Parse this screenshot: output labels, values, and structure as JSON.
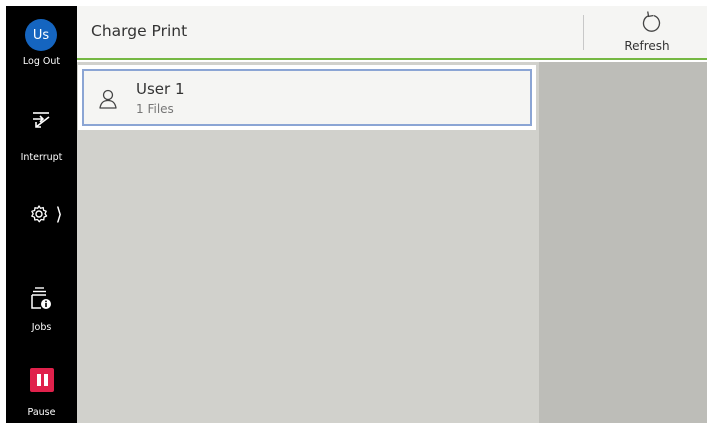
{
  "sidebar": {
    "avatar_initials": "Us",
    "logout_label": "Log Out",
    "interrupt_label": "Interrupt",
    "jobs_label": "Jobs",
    "pause_label": "Pause",
    "settings_chevron": "⟩"
  },
  "header": {
    "title": "Charge Print",
    "refresh_label": "Refresh"
  },
  "users": [
    {
      "name": "User 1",
      "files": "1 Files"
    }
  ],
  "colors": {
    "accent_green": "#75b843",
    "avatar_blue": "#1565c0",
    "pause_red": "#e0214b",
    "selection_border": "#8ba5d4"
  },
  "icons": {
    "interrupt": "interrupt-icon",
    "settings": "gear-icon",
    "jobs": "jobs-info-icon",
    "pause": "pause-icon",
    "refresh": "refresh-icon",
    "user": "user-icon"
  }
}
